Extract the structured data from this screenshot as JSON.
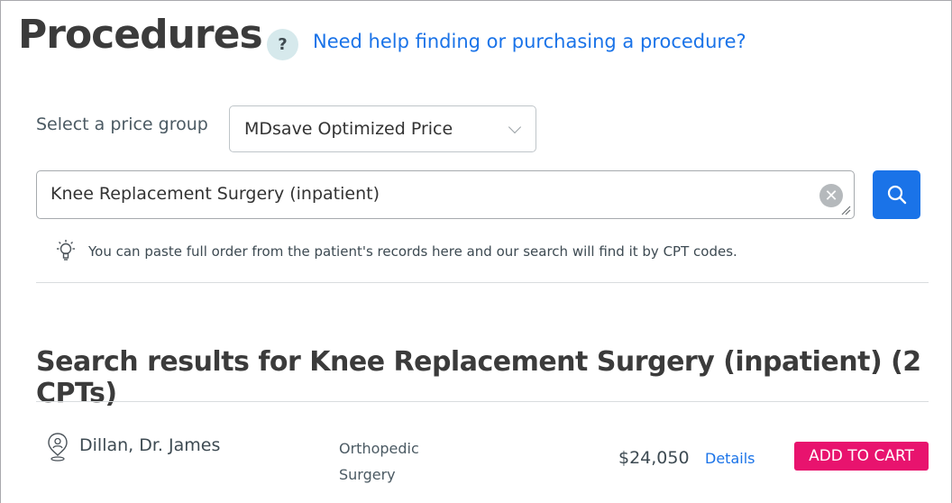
{
  "header": {
    "title": "Procedures",
    "help_icon_glyph": "?",
    "help_link": "Need help finding or purchasing a procedure?"
  },
  "price_group": {
    "label": "Select a price group",
    "selected": "MDsave Optimized Price"
  },
  "search": {
    "value": "Knee Replacement Surgery (inpatient)",
    "clear_glyph": "✕",
    "tip": "You can paste full order from the patient's records here and our search will find it by CPT codes."
  },
  "results": {
    "title": "Search results for Knee Replacement Surgery (inpatient) (2 CPTs)",
    "items": [
      {
        "provider": "Dillan, Dr. James",
        "specialty": "Orthopedic Surgery",
        "price": "$24,050",
        "details_label": "Details",
        "cart_label": "ADD TO CART"
      }
    ]
  },
  "colors": {
    "accent_blue": "#1a73e8",
    "cart_pink": "#e8136e",
    "help_bg": "#d6e9ec"
  },
  "icons": [
    "help-icon",
    "chevron-down-icon",
    "clear-icon",
    "search-icon",
    "lightbulb-icon",
    "provider-location-icon"
  ]
}
